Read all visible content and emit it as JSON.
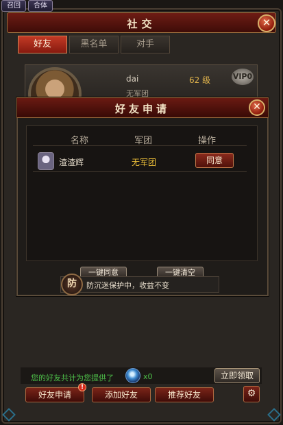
{
  "top_tabs": [
    "召回",
    "合体"
  ],
  "window": {
    "title": "社交"
  },
  "tabs": [
    {
      "label": "好友",
      "active": true
    },
    {
      "label": "黑名单",
      "active": false
    },
    {
      "label": "对手",
      "active": false
    }
  ],
  "friend": {
    "name": "dai",
    "level": "62 级",
    "vip": "VIP0",
    "legion": "无军团"
  },
  "dialog": {
    "title": "好友申请",
    "columns": [
      "名称",
      "军团",
      "操作"
    ],
    "requests": [
      {
        "name": "渣渣辉",
        "legion": "无军团",
        "action": "同意"
      }
    ],
    "bulk_agree": "一键同意",
    "bulk_clear": "一键清空"
  },
  "tip": {
    "icon_char": "防",
    "text": "防沉迷保护中，收益不变"
  },
  "footer": {
    "provided_text": "您的好友共计为您提供了",
    "gem_count": "x0",
    "claim_label": "立即领取",
    "buttons": [
      "好友申请",
      "添加好友",
      "推荐好友"
    ],
    "request_badge": "!"
  },
  "icons": {
    "close": "✕",
    "gear": "⚙"
  },
  "colors": {
    "accent_red": "#c33a25",
    "gold_text": "#f0c239",
    "green_text": "#4ec24a"
  }
}
